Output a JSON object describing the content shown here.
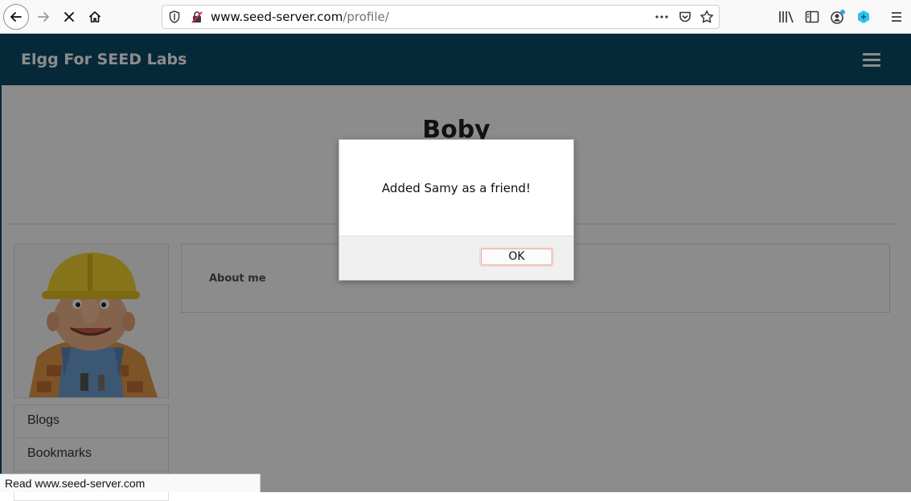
{
  "browser": {
    "url_domain": "www.seed-server.com",
    "url_path": "/profile/",
    "status_text": "Read www.seed-server.com"
  },
  "site": {
    "title": "Elgg For SEED Labs"
  },
  "profile": {
    "name": "Boby",
    "about_label": "About me",
    "menu": [
      {
        "label": "Blogs"
      },
      {
        "label": "Bookmarks"
      }
    ]
  },
  "dialog": {
    "message": "Added Samy as a friend!",
    "ok_label": "OK"
  },
  "colors": {
    "header_bg": "#0c4c68",
    "toolbar_bg": "#f9f9fa"
  }
}
